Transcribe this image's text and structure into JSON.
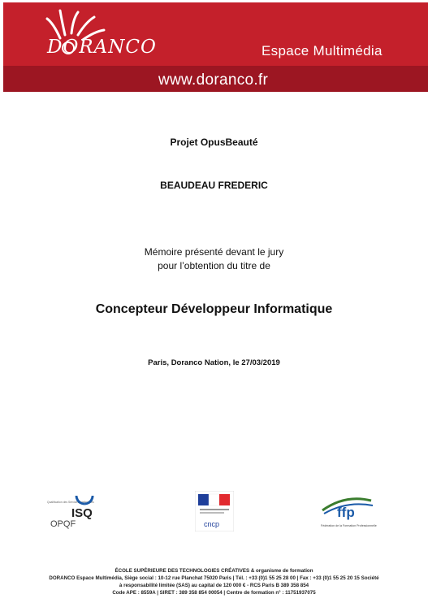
{
  "header": {
    "brand": "DORANCO",
    "subtitle": "Espace Multimédia",
    "url": "www.doranco.fr",
    "colors": {
      "red": "#c4202b",
      "dark_red": "#9c1622"
    }
  },
  "document": {
    "project": "Projet OpusBeauté",
    "author": "BEAUDEAU FREDERIC",
    "memoire_line1": "Mémoire présenté devant le jury",
    "memoire_line2": "pour l’obtention du titre de",
    "title": "Concepteur Développeur Informatique",
    "place_date": "Paris, Doranco Nation, le 27/03/2019"
  },
  "logos": {
    "isq_small": "Qualification des Services Intellectuels",
    "isq_brand": "ISQ",
    "opqf": "OPQF",
    "cncp": "cncp",
    "ffp": "ffp",
    "ffp_caption": "Fédération de la Formation Professionnelle"
  },
  "footer": {
    "line1": "ÉCOLE SUPÉRIEURE DES TECHNOLOGIES CRÉATIVES & organisme de formation",
    "line2": "DORANCO Espace Multimédia, Siège social : 10-12 rue Planchat 75020 Paris | Tél. : +33 (0)1 55 25 28 00 | Fax : +33 (0)1 55 25 20 15 Société",
    "line3": "à responsabilité limitée (SAS) au capital de 120 000 € - RCS Paris B 389 358 854",
    "line4": "Code APE : 8559A | SIRET : 389 358 854 00054 | Centre de formation n° : 11751937075"
  }
}
